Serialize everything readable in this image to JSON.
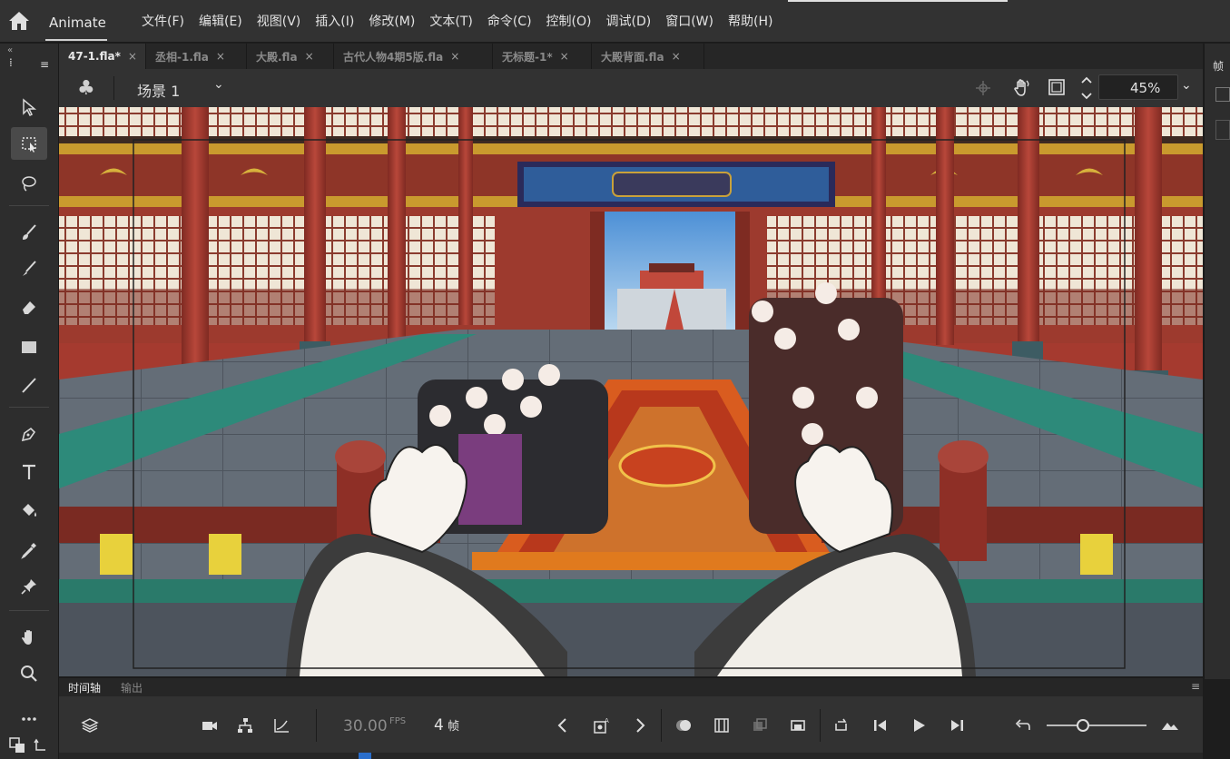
{
  "app": {
    "name": "Animate"
  },
  "menu": [
    "文件(F)",
    "编辑(E)",
    "视图(V)",
    "插入(I)",
    "修改(M)",
    "文本(T)",
    "命令(C)",
    "控制(O)",
    "调试(D)",
    "窗口(W)",
    "帮助(H)"
  ],
  "tabs": [
    {
      "label": "47-1.fla*",
      "close": "×"
    },
    {
      "label": "丞相-1.fla",
      "close": "×"
    },
    {
      "label": "大殿.fla",
      "close": "×"
    },
    {
      "label": "古代人物4期5版.fla",
      "close": "×"
    },
    {
      "label": "无标题-1*",
      "close": "×"
    },
    {
      "label": "大殿背面.fla",
      "close": "×"
    }
  ],
  "scene": {
    "label": "场景 1",
    "icon": "♣",
    "chevron": "⌄"
  },
  "zoom": {
    "value": "45%"
  },
  "right_panel": {
    "label": "帧"
  },
  "timeline": {
    "tab_active": "时间轴",
    "tab_other": "输出",
    "fps_value": "30.00",
    "fps_unit": "FPS",
    "frame_value": "4",
    "frame_unit": "帧"
  },
  "colors": {
    "accent": "#2a6ecb",
    "panel": "#323232",
    "stage_wall": "#a53a2f"
  }
}
